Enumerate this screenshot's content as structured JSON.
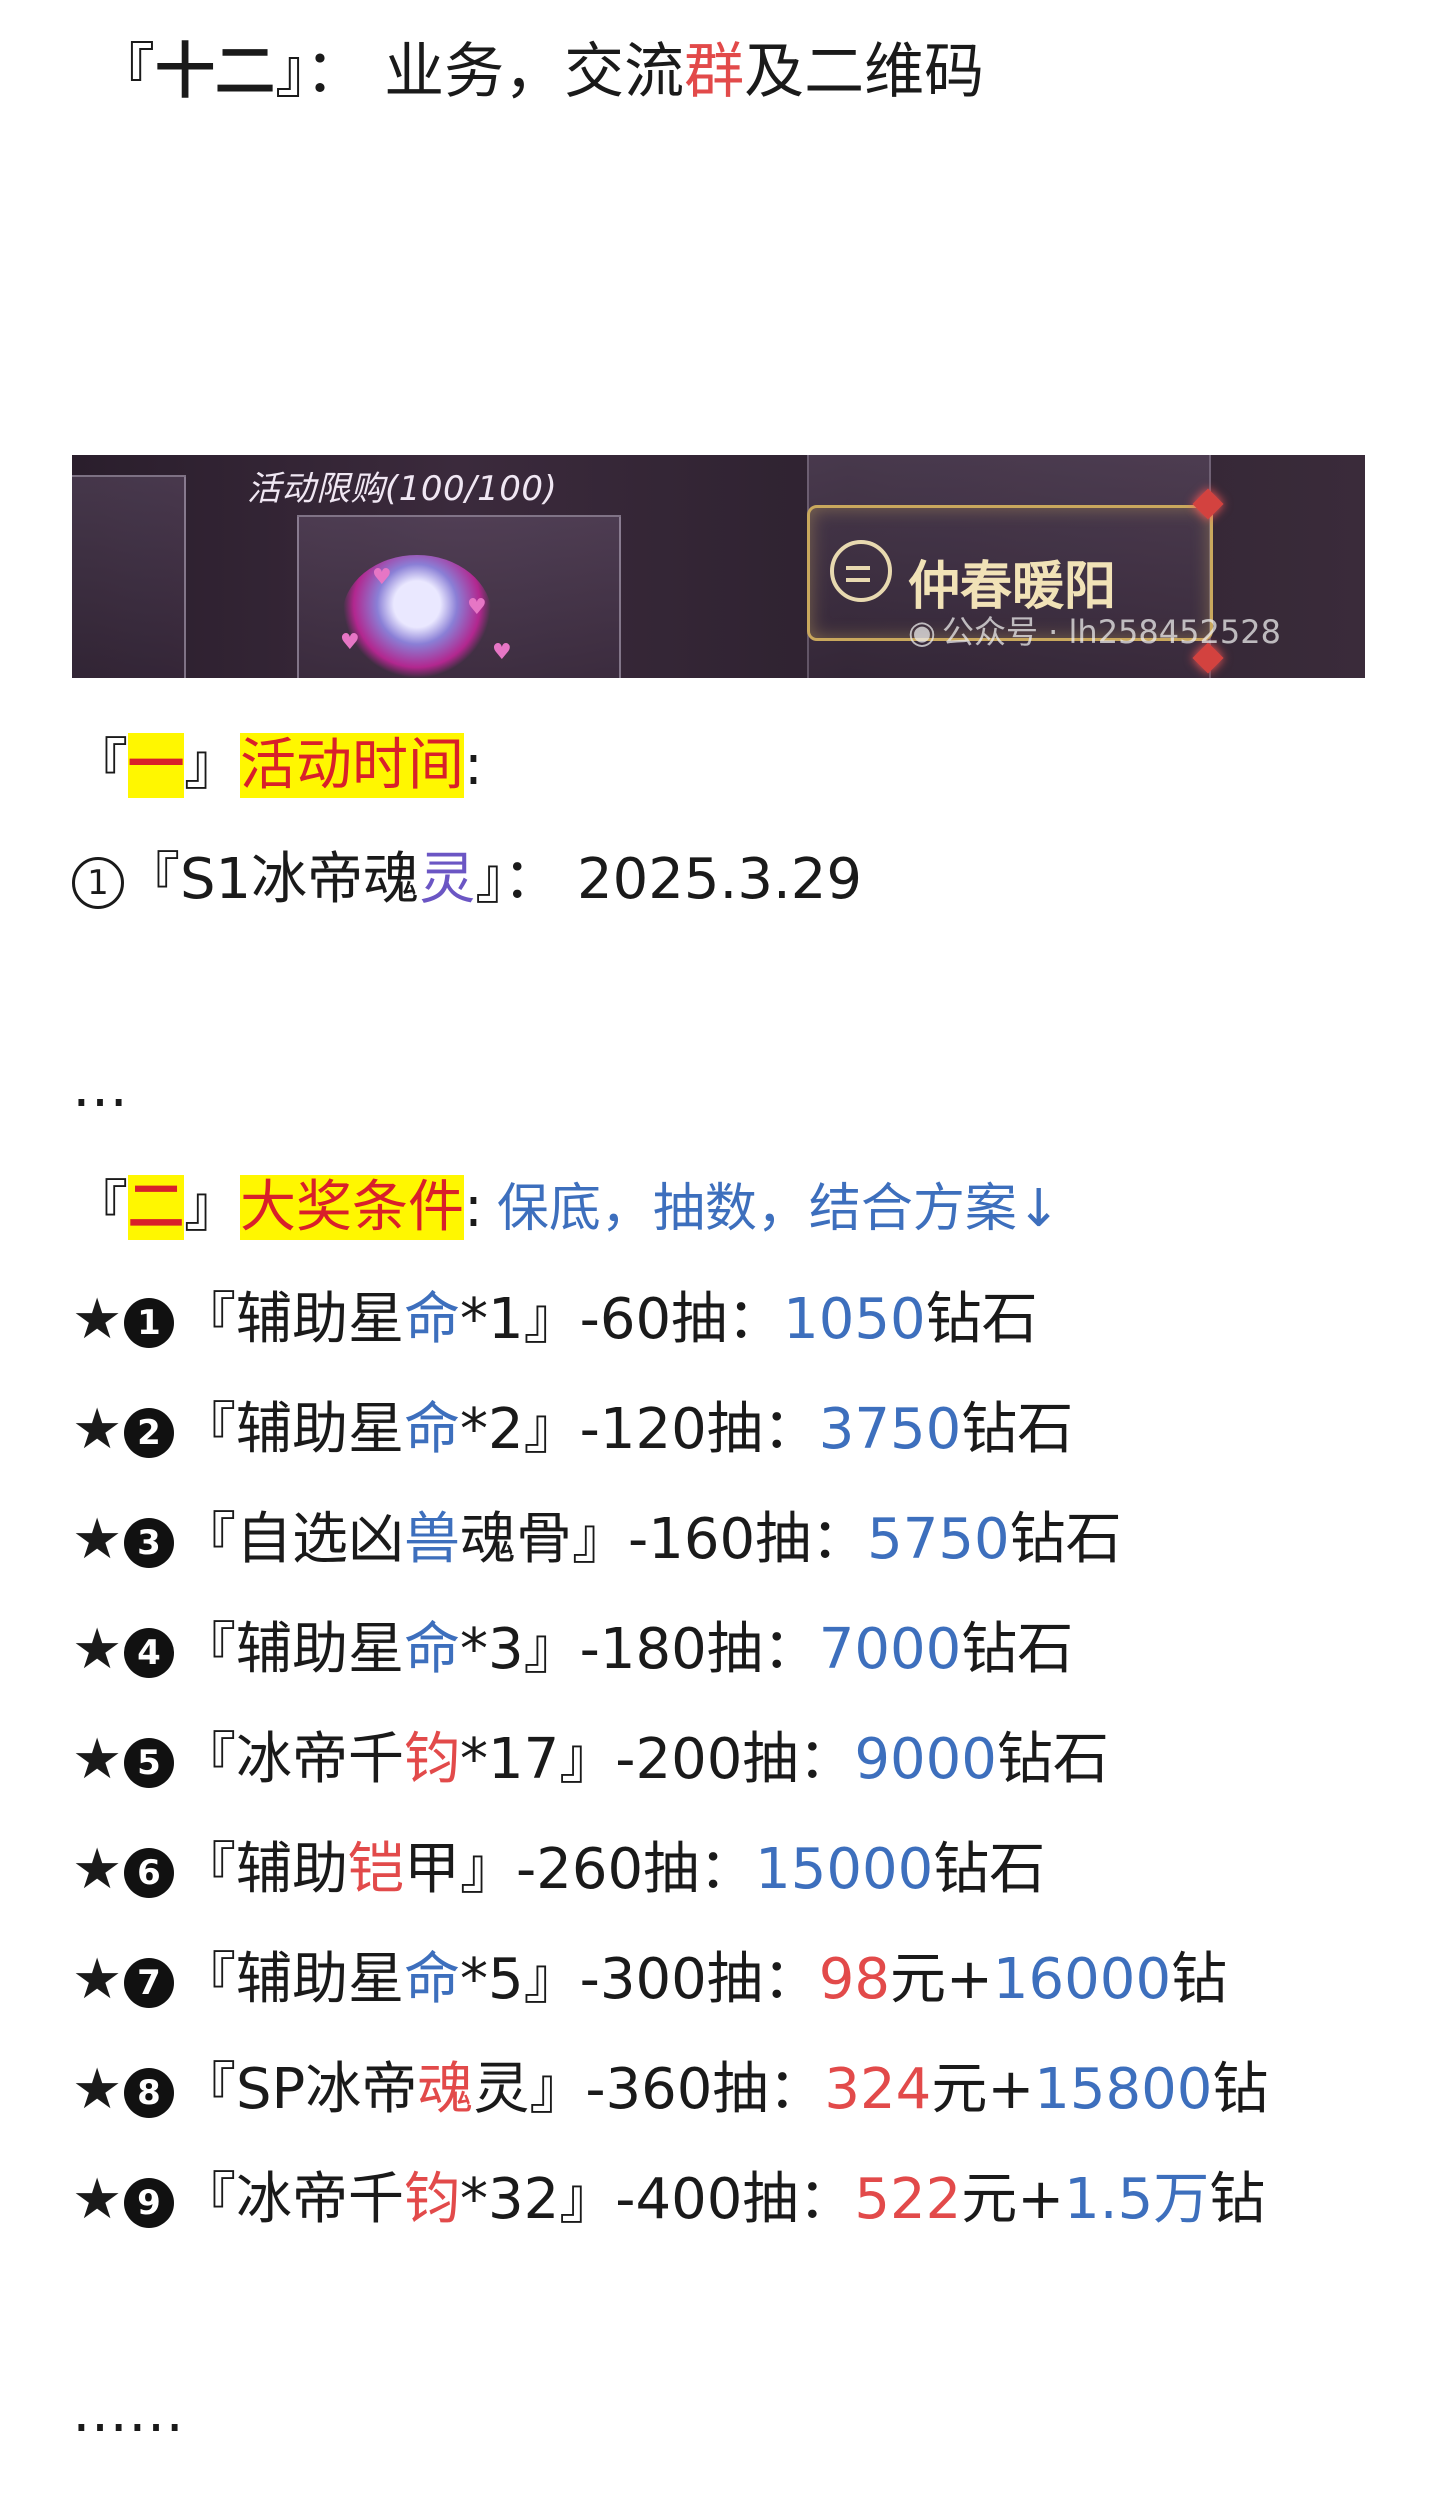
{
  "title": {
    "open": "『",
    "num": "十二",
    "close": "』：",
    "text_a": "业务，交流",
    "text_red": "群",
    "text_b": "及二维码"
  },
  "banner": {
    "limit": "活动限购(100/100)",
    "brand": "仲春暖阳",
    "watermark": "公众号 · lh258452528"
  },
  "section1": {
    "open": "『",
    "num": "一",
    "close": "』",
    "name": "活动时间",
    "colon": ":"
  },
  "date_row": {
    "marker": "1",
    "open": "『S1冰帝魂",
    "accent": "灵",
    "close": "』：",
    "value": "2025.3.29"
  },
  "ellipsis1": "…",
  "section2": {
    "open": "『",
    "num": "二",
    "close": "』",
    "name": "大奖条件",
    "colon": ":",
    "note": "保底，抽数，结合方案↓"
  },
  "star": "★",
  "rewards": [
    {
      "n": "1",
      "a": "『辅助星",
      "acc": "命",
      "b": "*1』-60抽：",
      "v1": "1050",
      "u1": "钻石",
      "v2": "",
      "u2": "",
      "acc_color": "blue"
    },
    {
      "n": "2",
      "a": "『辅助星",
      "acc": "命",
      "b": "*2』-120抽：",
      "v1": "3750",
      "u1": "钻石",
      "v2": "",
      "u2": "",
      "acc_color": "blue"
    },
    {
      "n": "3",
      "a": "『自选凶",
      "acc": "兽",
      "b": "魂骨』-160抽：",
      "v1": "5750",
      "u1": "钻石",
      "v2": "",
      "u2": "",
      "acc_color": "blue"
    },
    {
      "n": "4",
      "a": "『辅助星",
      "acc": "命",
      "b": "*3』-180抽：",
      "v1": "7000",
      "u1": "钻石",
      "v2": "",
      "u2": "",
      "acc_color": "blue"
    },
    {
      "n": "5",
      "a": "『冰帝千",
      "acc": "钧",
      "b": "*17』-200抽：",
      "v1": "9000",
      "u1": "钻石",
      "v2": "",
      "u2": "",
      "acc_color": "red"
    },
    {
      "n": "6",
      "a": "『辅助",
      "acc": "铠",
      "b": "甲』-260抽：",
      "v1": "15000",
      "u1": "钻石",
      "v2": "",
      "u2": "",
      "acc_color": "red"
    },
    {
      "n": "7",
      "a": "『辅助星",
      "acc": "命",
      "b": "*5』-300抽：",
      "v1": "98",
      "u1": "元+",
      "v2": "16000",
      "u2": "钻",
      "acc_color": "blue"
    },
    {
      "n": "8",
      "a": "『SP冰帝",
      "acc": "魂",
      "b": "灵』-360抽：",
      "v1": "324",
      "u1": "元+",
      "v2": "15800",
      "u2": "钻",
      "acc_color": "red"
    },
    {
      "n": "9",
      "a": "『冰帝千",
      "acc": "钧",
      "b": "*32』-400抽：",
      "v1": "522",
      "u1": "元+",
      "v2": "1.5万",
      "u2": "钻",
      "acc_color": "red"
    }
  ],
  "ellipsis2": "……",
  "colors": {
    "accent_red": "#e24a4a",
    "accent_blue": "#3d6fbd",
    "highlight": "#fff700"
  }
}
